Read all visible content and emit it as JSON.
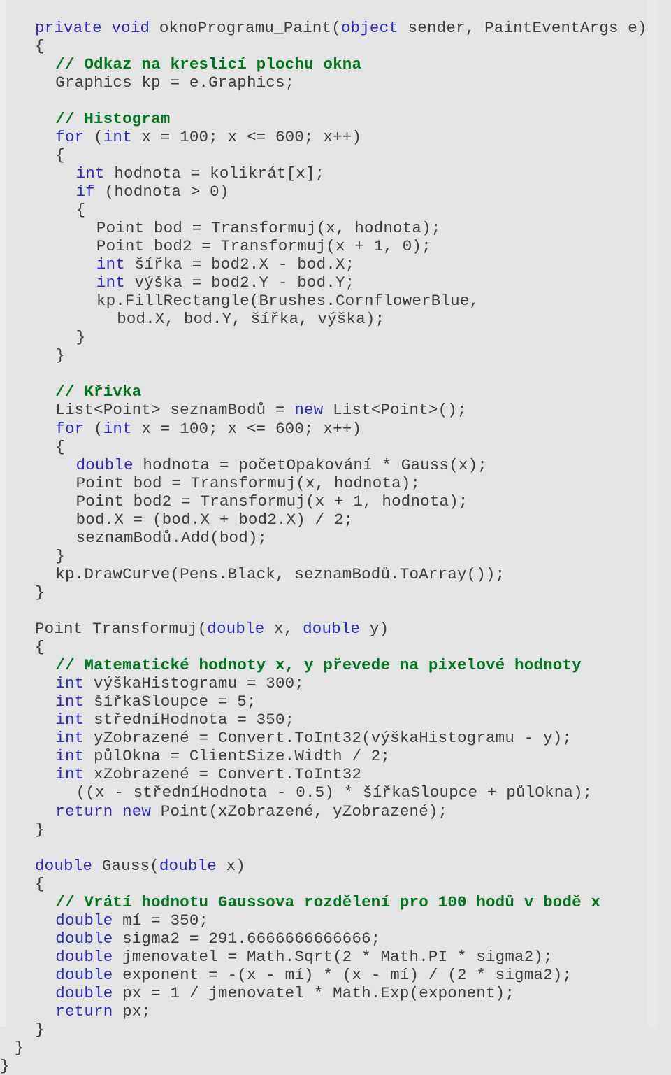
{
  "document": {
    "kind": "source-code-listing",
    "language": "C#",
    "background_color": "#e4e4e4",
    "colors": {
      "plain_text": "#3d3d3d",
      "keyword": "#2b2bc4",
      "comment": "#00761f"
    }
  },
  "code": {
    "lines": [
      {
        "indent": 0,
        "tokens": [
          {
            "t": "kw",
            "s": "private void "
          },
          {
            "t": "pl",
            "s": "oknoProgramu_Paint("
          },
          {
            "t": "kw",
            "s": "object"
          },
          {
            "t": "pl",
            "s": " sender, PaintEventArgs e)"
          }
        ]
      },
      {
        "indent": 0,
        "tokens": [
          {
            "t": "pl",
            "s": "{"
          }
        ]
      },
      {
        "indent": 1,
        "tokens": [
          {
            "t": "cmt",
            "s": "// Odkaz na kreslicí plochu okna"
          }
        ]
      },
      {
        "indent": 1,
        "tokens": [
          {
            "t": "pl",
            "s": "Graphics kp = e.Graphics;"
          }
        ]
      },
      {
        "indent": 0,
        "tokens": [
          {
            "t": "pl",
            "s": ""
          }
        ]
      },
      {
        "indent": 1,
        "tokens": [
          {
            "t": "cmt",
            "s": "// Histogram"
          }
        ]
      },
      {
        "indent": 1,
        "tokens": [
          {
            "t": "kw",
            "s": "for"
          },
          {
            "t": "pl",
            "s": " ("
          },
          {
            "t": "kw",
            "s": "int"
          },
          {
            "t": "pl",
            "s": " x = 100; x <= 600; x++)"
          }
        ]
      },
      {
        "indent": 1,
        "tokens": [
          {
            "t": "pl",
            "s": "{"
          }
        ]
      },
      {
        "indent": 2,
        "tokens": [
          {
            "t": "kw",
            "s": "int"
          },
          {
            "t": "pl",
            "s": " hodnota = kolikrát[x];"
          }
        ]
      },
      {
        "indent": 2,
        "tokens": [
          {
            "t": "kw",
            "s": "if"
          },
          {
            "t": "pl",
            "s": " (hodnota > 0)"
          }
        ]
      },
      {
        "indent": 2,
        "tokens": [
          {
            "t": "pl",
            "s": "{"
          }
        ]
      },
      {
        "indent": 3,
        "tokens": [
          {
            "t": "pl",
            "s": "Point bod = Transformuj(x, hodnota);"
          }
        ]
      },
      {
        "indent": 3,
        "tokens": [
          {
            "t": "pl",
            "s": "Point bod2 = Transformuj(x + 1, 0);"
          }
        ]
      },
      {
        "indent": 3,
        "tokens": [
          {
            "t": "kw",
            "s": "int"
          },
          {
            "t": "pl",
            "s": " šířka = bod2.X - bod.X;"
          }
        ]
      },
      {
        "indent": 3,
        "tokens": [
          {
            "t": "kw",
            "s": "int"
          },
          {
            "t": "pl",
            "s": " výška = bod2.Y - bod.Y;"
          }
        ]
      },
      {
        "indent": 3,
        "tokens": [
          {
            "t": "pl",
            "s": "kp.FillRectangle(Brushes.CornflowerBlue,"
          }
        ]
      },
      {
        "indent": 4,
        "tokens": [
          {
            "t": "pl",
            "s": "bod.X, bod.Y, šířka, výška);"
          }
        ]
      },
      {
        "indent": 2,
        "tokens": [
          {
            "t": "pl",
            "s": "}"
          }
        ]
      },
      {
        "indent": 1,
        "tokens": [
          {
            "t": "pl",
            "s": "}"
          }
        ]
      },
      {
        "indent": 0,
        "tokens": [
          {
            "t": "pl",
            "s": ""
          }
        ]
      },
      {
        "indent": 1,
        "tokens": [
          {
            "t": "cmt",
            "s": "// Křivka"
          }
        ]
      },
      {
        "indent": 1,
        "tokens": [
          {
            "t": "pl",
            "s": "List<Point> seznamBodů = "
          },
          {
            "t": "kw",
            "s": "new"
          },
          {
            "t": "pl",
            "s": " List<Point>();"
          }
        ]
      },
      {
        "indent": 1,
        "tokens": [
          {
            "t": "kw",
            "s": "for"
          },
          {
            "t": "pl",
            "s": " ("
          },
          {
            "t": "kw",
            "s": "int"
          },
          {
            "t": "pl",
            "s": " x = 100; x <= 600; x++)"
          }
        ]
      },
      {
        "indent": 1,
        "tokens": [
          {
            "t": "pl",
            "s": "{"
          }
        ]
      },
      {
        "indent": 2,
        "tokens": [
          {
            "t": "kw",
            "s": "double"
          },
          {
            "t": "pl",
            "s": " hodnota = početOpakování * Gauss(x);"
          }
        ]
      },
      {
        "indent": 2,
        "tokens": [
          {
            "t": "pl",
            "s": "Point bod = Transformuj(x, hodnota);"
          }
        ]
      },
      {
        "indent": 2,
        "tokens": [
          {
            "t": "pl",
            "s": "Point bod2 = Transformuj(x + 1, hodnota);"
          }
        ]
      },
      {
        "indent": 2,
        "tokens": [
          {
            "t": "pl",
            "s": "bod.X = (bod.X + bod2.X) / 2;"
          }
        ]
      },
      {
        "indent": 2,
        "tokens": [
          {
            "t": "pl",
            "s": "seznamBodů.Add(bod);"
          }
        ]
      },
      {
        "indent": 1,
        "tokens": [
          {
            "t": "pl",
            "s": "}"
          }
        ]
      },
      {
        "indent": 1,
        "tokens": [
          {
            "t": "pl",
            "s": "kp.DrawCurve(Pens.Black, seznamBodů.ToArray());"
          }
        ]
      },
      {
        "indent": 0,
        "tokens": [
          {
            "t": "pl",
            "s": "}"
          }
        ]
      },
      {
        "indent": 0,
        "tokens": [
          {
            "t": "pl",
            "s": ""
          }
        ]
      },
      {
        "indent": 0,
        "tokens": [
          {
            "t": "pl",
            "s": "Point Transformuj("
          },
          {
            "t": "kw",
            "s": "double"
          },
          {
            "t": "pl",
            "s": " x, "
          },
          {
            "t": "kw",
            "s": "double"
          },
          {
            "t": "pl",
            "s": " y)"
          }
        ]
      },
      {
        "indent": 0,
        "tokens": [
          {
            "t": "pl",
            "s": "{"
          }
        ]
      },
      {
        "indent": 1,
        "tokens": [
          {
            "t": "cmt",
            "s": "// Matematické hodnoty x, y převede na pixelové hodnoty"
          }
        ]
      },
      {
        "indent": 1,
        "tokens": [
          {
            "t": "kw",
            "s": "int"
          },
          {
            "t": "pl",
            "s": " výškaHistogramu = 300;"
          }
        ]
      },
      {
        "indent": 1,
        "tokens": [
          {
            "t": "kw",
            "s": "int"
          },
          {
            "t": "pl",
            "s": " šířkaSloupce = 5;"
          }
        ]
      },
      {
        "indent": 1,
        "tokens": [
          {
            "t": "kw",
            "s": "int"
          },
          {
            "t": "pl",
            "s": " středníHodnota = 350;"
          }
        ]
      },
      {
        "indent": 1,
        "tokens": [
          {
            "t": "kw",
            "s": "int"
          },
          {
            "t": "pl",
            "s": " yZobrazené = Convert.ToInt32(výškaHistogramu - y);"
          }
        ]
      },
      {
        "indent": 1,
        "tokens": [
          {
            "t": "kw",
            "s": "int"
          },
          {
            "t": "pl",
            "s": " půlOkna = ClientSize.Width / 2;"
          }
        ]
      },
      {
        "indent": 1,
        "tokens": [
          {
            "t": "kw",
            "s": "int"
          },
          {
            "t": "pl",
            "s": " xZobrazené = Convert.ToInt32"
          }
        ]
      },
      {
        "indent": 2,
        "tokens": [
          {
            "t": "pl",
            "s": "((x - středníHodnota - 0.5) * šířkaSloupce + půlOkna);"
          }
        ]
      },
      {
        "indent": 1,
        "tokens": [
          {
            "t": "kw",
            "s": "return new"
          },
          {
            "t": "pl",
            "s": " Point(xZobrazené, yZobrazené);"
          }
        ]
      },
      {
        "indent": 0,
        "tokens": [
          {
            "t": "pl",
            "s": "}"
          }
        ]
      },
      {
        "indent": 0,
        "tokens": [
          {
            "t": "pl",
            "s": ""
          }
        ]
      },
      {
        "indent": 0,
        "tokens": [
          {
            "t": "kw",
            "s": "double"
          },
          {
            "t": "pl",
            "s": " Gauss("
          },
          {
            "t": "kw",
            "s": "double"
          },
          {
            "t": "pl",
            "s": " x)"
          }
        ]
      },
      {
        "indent": 0,
        "tokens": [
          {
            "t": "pl",
            "s": "{"
          }
        ]
      },
      {
        "indent": 1,
        "tokens": [
          {
            "t": "cmt",
            "s": "// Vrátí hodnotu Gaussova rozdělení pro 100 hodů v bodě x"
          }
        ]
      },
      {
        "indent": 1,
        "tokens": [
          {
            "t": "kw",
            "s": "double"
          },
          {
            "t": "pl",
            "s": " mí = 350;"
          }
        ]
      },
      {
        "indent": 1,
        "tokens": [
          {
            "t": "kw",
            "s": "double"
          },
          {
            "t": "pl",
            "s": " sigma2 = 291.6666666666666;"
          }
        ]
      },
      {
        "indent": 1,
        "tokens": [
          {
            "t": "kw",
            "s": "double"
          },
          {
            "t": "pl",
            "s": " jmenovatel = Math.Sqrt(2 * Math.PI * sigma2);"
          }
        ]
      },
      {
        "indent": 1,
        "tokens": [
          {
            "t": "kw",
            "s": "double"
          },
          {
            "t": "pl",
            "s": " exponent = -(x - mí) * (x - mí) / (2 * sigma2);"
          }
        ]
      },
      {
        "indent": 1,
        "tokens": [
          {
            "t": "kw",
            "s": "double"
          },
          {
            "t": "pl",
            "s": " px = 1 / jmenovatel * Math.Exp(exponent);"
          }
        ]
      },
      {
        "indent": 1,
        "tokens": [
          {
            "t": "kw",
            "s": "return"
          },
          {
            "t": "pl",
            "s": " px;"
          }
        ]
      },
      {
        "indent": 0,
        "tokens": [
          {
            "t": "pl",
            "s": "}"
          }
        ]
      },
      {
        "indent": -1,
        "tokens": [
          {
            "t": "pl",
            "s": "}"
          }
        ]
      },
      {
        "indent": -2,
        "tokens": [
          {
            "t": "pl",
            "s": "}"
          }
        ]
      }
    ]
  }
}
